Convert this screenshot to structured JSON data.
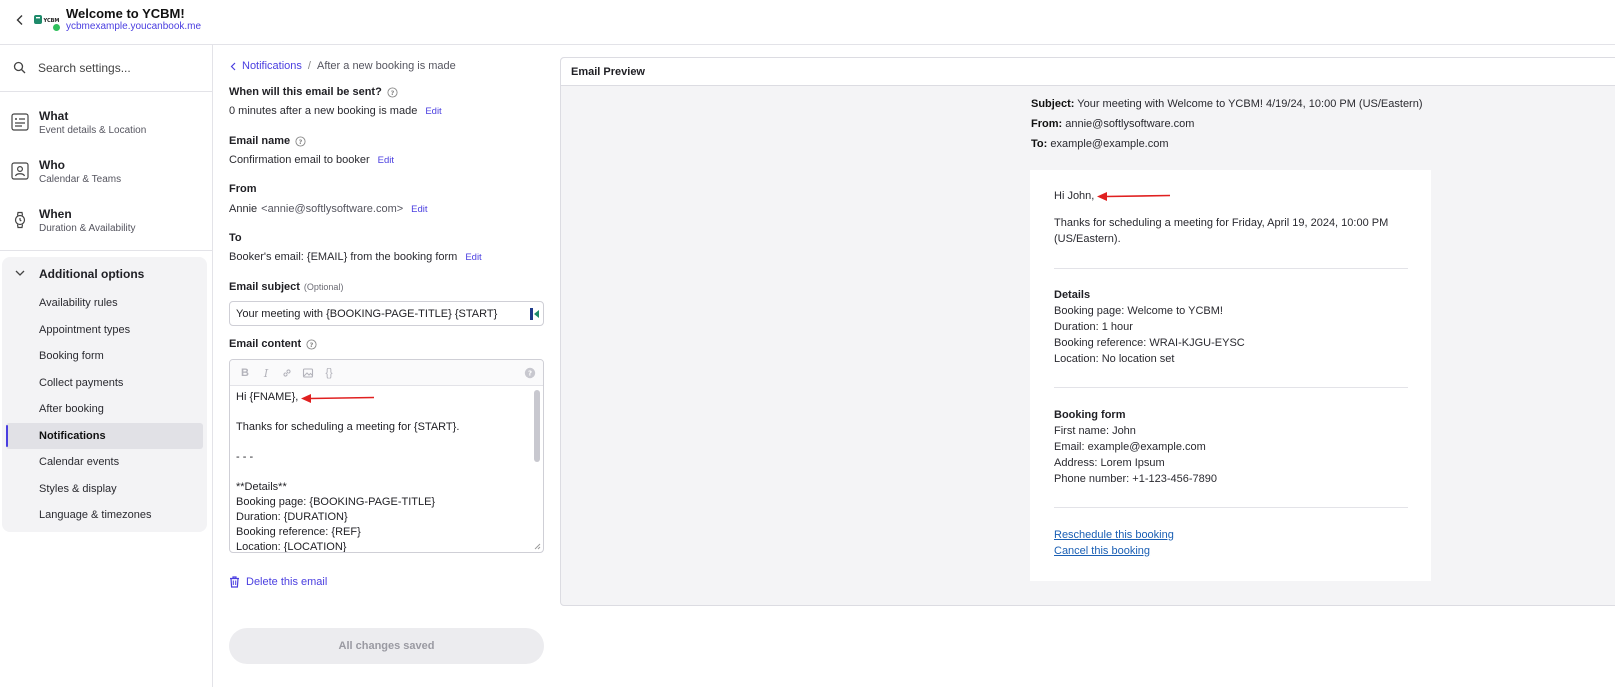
{
  "header": {
    "title": "Welcome to YCBM!",
    "url": "ycbmexample.youcanbook.me",
    "logo_text": "YCBM"
  },
  "sidebar": {
    "search_placeholder": "Search settings...",
    "main_items": [
      {
        "label": "What",
        "sub": "Event details & Location",
        "icon": "form-icon"
      },
      {
        "label": "Who",
        "sub": "Calendar & Teams",
        "icon": "contact-card-icon"
      },
      {
        "label": "When",
        "sub": "Duration & Availability",
        "icon": "watch-icon"
      }
    ],
    "additional": {
      "label": "Additional options",
      "items": [
        {
          "label": "Availability rules"
        },
        {
          "label": "Appointment types"
        },
        {
          "label": "Booking form"
        },
        {
          "label": "Collect payments"
        },
        {
          "label": "After booking"
        },
        {
          "label": "Notifications",
          "active": true
        },
        {
          "label": "Calendar events"
        },
        {
          "label": "Styles & display"
        },
        {
          "label": "Language & timezones"
        }
      ]
    }
  },
  "settings": {
    "breadcrumb": {
      "parent": "Notifications",
      "current": "After a new booking is made"
    },
    "when_label": "When will this email be sent?",
    "when_value": "0 minutes after a new booking is made",
    "name_label": "Email name",
    "name_value": "Confirmation email to booker",
    "from_label": "From",
    "from_name": "Annie",
    "from_email": "<annie@softlysoftware.com>",
    "to_label": "To",
    "to_value": "Booker's email: {EMAIL} from the booking form",
    "edit_label": "Edit",
    "subject_label": "Email subject",
    "subject_optional": "(Optional)",
    "subject_value": "Your meeting with {BOOKING-PAGE-TITLE} {START}",
    "content_label": "Email content",
    "content_lines": [
      "Hi {FNAME},",
      "",
      "Thanks for scheduling a meeting for {START}.",
      "",
      "- - -",
      "",
      "**Details**",
      "Booking page: {BOOKING-PAGE-TITLE}",
      "Duration: {DURATION}",
      "Booking reference: {REF}",
      "Location: {LOCATION}"
    ],
    "delete_label": "Delete this email",
    "save_label": "All changes saved"
  },
  "preview": {
    "title": "Email Preview",
    "subject_key": "Subject:",
    "subject": "Your meeting with Welcome to YCBM! 4/19/24, 10:00 PM (US/Eastern)",
    "from_key": "From:",
    "from": "annie@softlysoftware.com",
    "to_key": "To:",
    "to": "example@example.com",
    "greeting": "Hi John,",
    "thanks_line1": "Thanks for scheduling a meeting for Friday, April 19, 2024, 10:00 PM",
    "thanks_line2": "(US/Eastern).",
    "details_heading": "Details",
    "details": [
      "Booking page: Welcome to YCBM!",
      "Duration: 1 hour",
      "Booking reference: WRAI-KJGU-EYSC",
      "Location: No location set"
    ],
    "form_heading": "Booking form",
    "form": [
      "First name: John",
      "Email: example@example.com",
      "Address: Lorem Ipsum",
      "Phone number: +1-123-456-7890"
    ],
    "reschedule_link": "Reschedule this booking",
    "cancel_link": "Cancel this booking"
  },
  "colors": {
    "accent": "#4a3ee0",
    "arrow": "#e02020",
    "link": "#1a5fb4"
  }
}
